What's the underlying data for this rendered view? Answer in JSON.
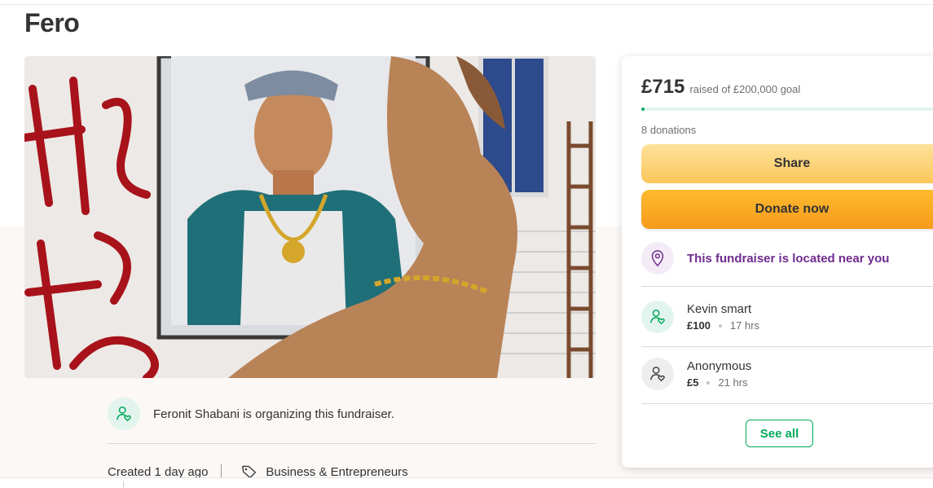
{
  "page": {
    "title": "Fero"
  },
  "organizer": {
    "text": "Feronit Shabani is organizing this fundraiser."
  },
  "meta": {
    "created": "Created 1 day ago",
    "category": "Business & Entrepreneurs"
  },
  "donation_card": {
    "amount": "£715",
    "goal_text": "raised of £200,000 goal",
    "progress_fraction": 0.0036,
    "donations_count": "8 donations",
    "share_label": "Share",
    "donate_label": "Donate now",
    "location_text": "This fundraiser is located near you",
    "donors": [
      {
        "name": "Kevin smart",
        "amount": "£100",
        "time": "17 hrs",
        "icon": "heart-hand-icon"
      },
      {
        "name": "Anonymous",
        "amount": "£5",
        "time": "21 hrs",
        "icon": "heart-hand-icon"
      }
    ],
    "see_all_label": "See all"
  },
  "colors": {
    "brand_green": "#02a95c",
    "location_purple": "#6f2b8f",
    "donate_orange": "#f79a1b",
    "share_yellow": "#fcc75c"
  },
  "icons": {
    "organizer": "heart-hand-icon",
    "location": "map-pin-icon",
    "category": "tag-icon"
  }
}
